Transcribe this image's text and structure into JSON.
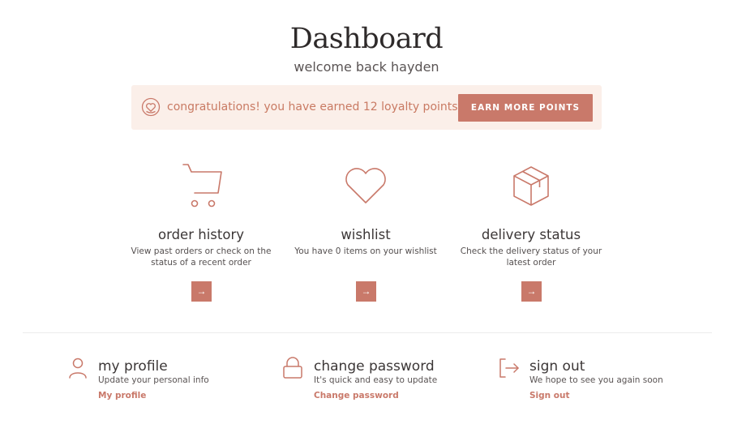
{
  "header": {
    "title": "Dashboard",
    "subtitle": "welcome back hayden"
  },
  "loyalty_banner": {
    "message": "congratulations! you have earned 12 loyalty points",
    "button_label": "EARN MORE POINTS",
    "icon": "heart-coin-icon"
  },
  "features": [
    {
      "icon": "shopping-cart-icon",
      "title": "order history",
      "description": "View past orders or check on the status of a recent order",
      "arrow": "→"
    },
    {
      "icon": "heart-icon",
      "title": "wishlist",
      "description": "You have 0 items on your wishlist",
      "arrow": "→"
    },
    {
      "icon": "package-box-icon",
      "title": "delivery status",
      "description": "Check the delivery status of your latest order",
      "arrow": "→"
    }
  ],
  "account_links": [
    {
      "icon": "user-icon",
      "title": "my profile",
      "description": "Update your personal info",
      "link": "My profile"
    },
    {
      "icon": "lock-icon",
      "title": "change password",
      "description": "It's quick and easy to update",
      "link": "Change password"
    },
    {
      "icon": "sign-out-icon",
      "title": "sign out",
      "description": "We hope to see you again soon",
      "link": "Sign out"
    }
  ],
  "colors": {
    "accent": "#c9796a",
    "banner_bg": "#fbefe9",
    "text": "#3c3737"
  }
}
